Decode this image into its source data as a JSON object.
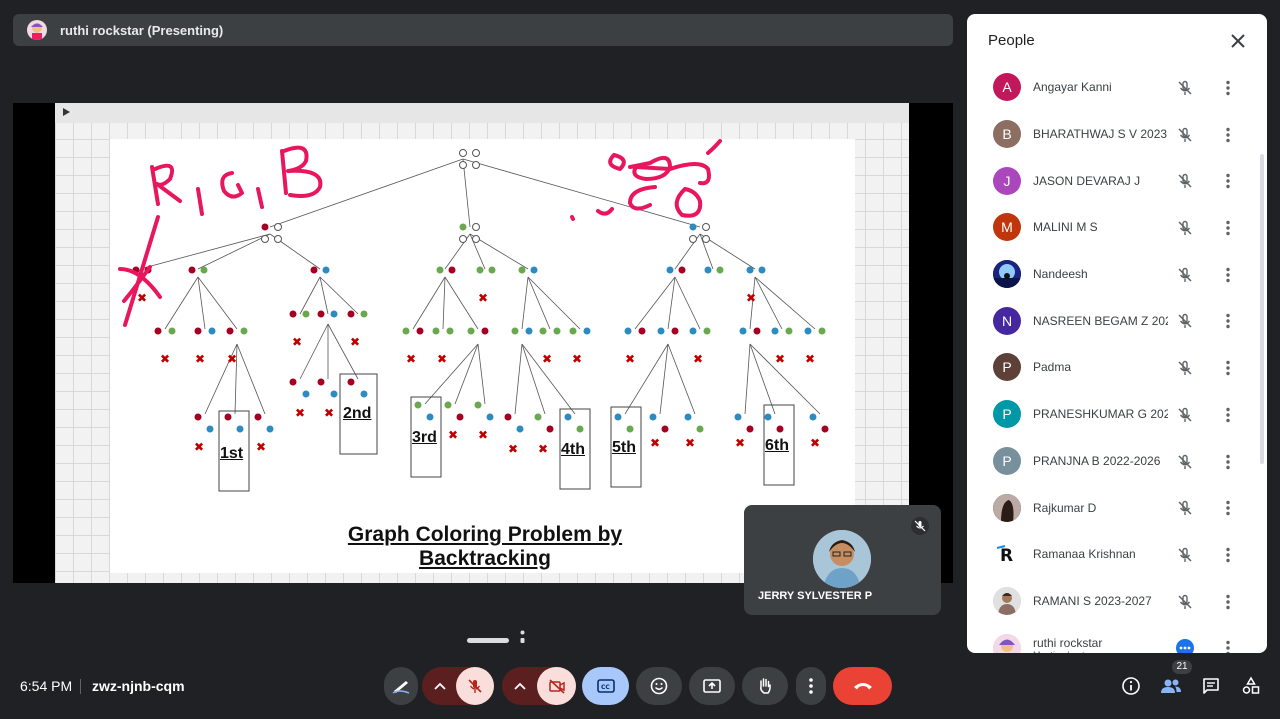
{
  "presenter": {
    "label": "ruthi rockstar (Presenting)"
  },
  "slide": {
    "title": "Graph Coloring Problem by Backtracking",
    "orders": [
      "1st",
      "2nd",
      "3rd",
      "4th",
      "5th",
      "6th"
    ],
    "annotation": "R, G, B"
  },
  "self_tile": {
    "name": "JERRY SYLVESTER P"
  },
  "people_panel": {
    "title": "People",
    "participants": [
      {
        "name": "Angayar Kanni",
        "initial": "A",
        "color": "#c2185b"
      },
      {
        "name": "BHARATHWAJ S V 2023...",
        "initial": "B",
        "color": "#8d6e63"
      },
      {
        "name": "JASON DEVARAJ J",
        "initial": "J",
        "color": "#ab47bc"
      },
      {
        "name": "MALINI M S",
        "initial": "M",
        "color": "#bf360c"
      },
      {
        "name": "Nandeesh",
        "initial": "",
        "color": "#1a237e"
      },
      {
        "name": "NASREEN BEGAM Z 202...",
        "initial": "N",
        "color": "#4527a0"
      },
      {
        "name": "Padma",
        "initial": "P",
        "color": "#5d4037"
      },
      {
        "name": "PRANESHKUMAR G 202...",
        "initial": "P",
        "color": "#0097a7"
      },
      {
        "name": "PRANJNA B 2022-2026",
        "initial": "P",
        "color": "#78909c"
      },
      {
        "name": "Rajkumar D",
        "initial": "",
        "color": "#3e2723"
      },
      {
        "name": "Ramanaa Krishnan",
        "initial": "R",
        "color": "#ffffff"
      },
      {
        "name": "RAMANI S 2023-2027",
        "initial": "",
        "color": "#d7ccc8"
      },
      {
        "name": "ruthi rockstar",
        "initial": "",
        "color": "#f3d9e6",
        "subtitle": "Meeting host"
      }
    ]
  },
  "bottom_bar": {
    "time": "6:54 PM",
    "meeting_code": "zwz-njnb-cqm",
    "people_count": "21"
  },
  "colors": {
    "background": "#202124",
    "end_call": "#ea4335",
    "mic_off": "#f9dedc",
    "captions": "#a8c7fa"
  }
}
